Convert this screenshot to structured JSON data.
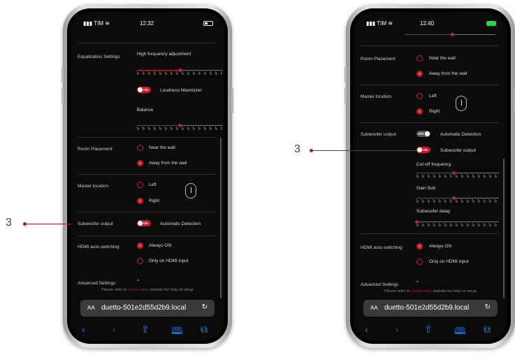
{
  "callouts": {
    "left_number": "3",
    "right_number": "3"
  },
  "colors": {
    "accent": "#c21d2e",
    "background": "#0b0b0b",
    "link_blue": "#0a84ff"
  },
  "left_phone": {
    "status": {
      "carrier": "TIM",
      "time": "12:32"
    },
    "equalization": {
      "section_label": "Equalization Settings",
      "high_freq_label": "High frequency adjustment",
      "high_freq_value": 0.5,
      "loudness_toggle": "ON",
      "loudness_label": "Loudness Maximizer",
      "balance_label": "Balance",
      "balance_value": 0.5
    },
    "room_placement": {
      "label": "Room Placement",
      "options": [
        "Near the wall",
        "Away from the wall"
      ],
      "selected": "Away from the wall"
    },
    "master_location": {
      "label": "Master location",
      "options": [
        "Left",
        "Right"
      ],
      "selected": "Right"
    },
    "subwoofer": {
      "label": "Subwoofer output",
      "toggle": "ON",
      "toggle_label": "Automatic Detection"
    },
    "hdmi": {
      "label": "HDMI auto switching",
      "options": [
        "Always ON",
        "Only on HDMI input"
      ],
      "selected": "Always ON"
    },
    "advanced": {
      "label": "Advanced Settings",
      "chevron": "^"
    },
    "help": {
      "prefix": "Please refer to ",
      "link": "Sonus faber",
      "suffix": " website for help on setup"
    },
    "url_bar": {
      "aa": "AA",
      "url": "duetto-501e2d55d2b9.local",
      "reload_icon": "reload-icon"
    },
    "toolbar_icons": [
      "back-icon",
      "forward-icon",
      "share-icon",
      "bookmarks-icon",
      "tabs-icon"
    ]
  },
  "right_phone": {
    "status": {
      "carrier": "TIM",
      "time": "12:40"
    },
    "room_placement": {
      "label": "Room Placement",
      "options": [
        "Near the wall",
        "Away from the wall"
      ],
      "selected": "Away from the wall"
    },
    "master_location": {
      "label": "Master location",
      "options": [
        "Left",
        "Right"
      ],
      "selected": "Right"
    },
    "subwoofer": {
      "label": "Subwoofer output",
      "auto_toggle": "OFF",
      "auto_label": "Automatic Detection",
      "output_toggle": "ON",
      "output_label": "Subwoofer output",
      "cutoff_label": "Cut-off frequency",
      "cutoff_value": 0.45,
      "gain_label": "Gain Sub",
      "gain_value": 0.45,
      "delay_label": "Subwoofer delay",
      "delay_value": 0.0
    },
    "hdmi": {
      "label": "HDMI auto switching",
      "options": [
        "Always ON",
        "Only on HDMI input"
      ],
      "selected": "Always ON"
    },
    "advanced": {
      "label": "Advanced Settings",
      "chevron": "^"
    },
    "help": {
      "prefix": "Please refer to ",
      "link": "Sonus faber",
      "suffix": " website for help on setup"
    },
    "url_bar": {
      "aa": "AA",
      "url": "duetto-501e2d55d2b9.local",
      "reload_icon": "reload-icon"
    },
    "toolbar_icons": [
      "back-icon",
      "forward-icon",
      "share-icon",
      "bookmarks-icon",
      "tabs-icon"
    ]
  }
}
